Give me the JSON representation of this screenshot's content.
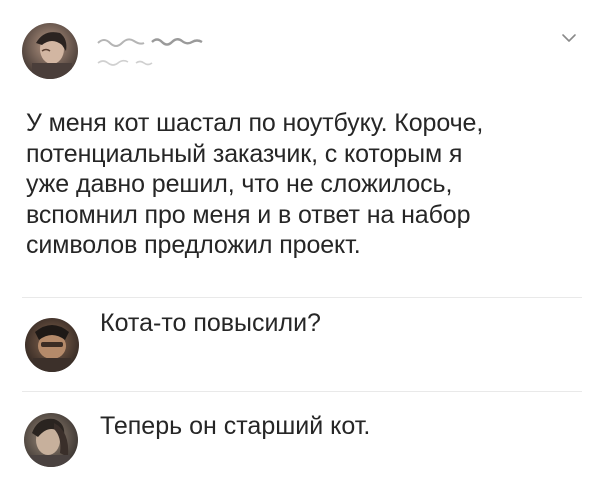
{
  "post": {
    "author_avatar_icon": "user-avatar-photo",
    "chevron_icon": "chevron-down-icon",
    "text": "У меня кот шастал по ноутбуку. Короче,\nпотенциальный заказчик, с которым я\nуже давно решил, что не сложилось,\nвспомнил про меня и в ответ на набор\nсимволов предложил проект."
  },
  "comments": [
    {
      "avatar_icon": "user-avatar-photo",
      "text": "Кота-то повысили?"
    },
    {
      "avatar_icon": "user-avatar-photo",
      "text": "Теперь он старший кот."
    }
  ],
  "colors": {
    "text": "#262626",
    "divider": "#e9e9e9",
    "chevron": "#8a8a8a"
  }
}
